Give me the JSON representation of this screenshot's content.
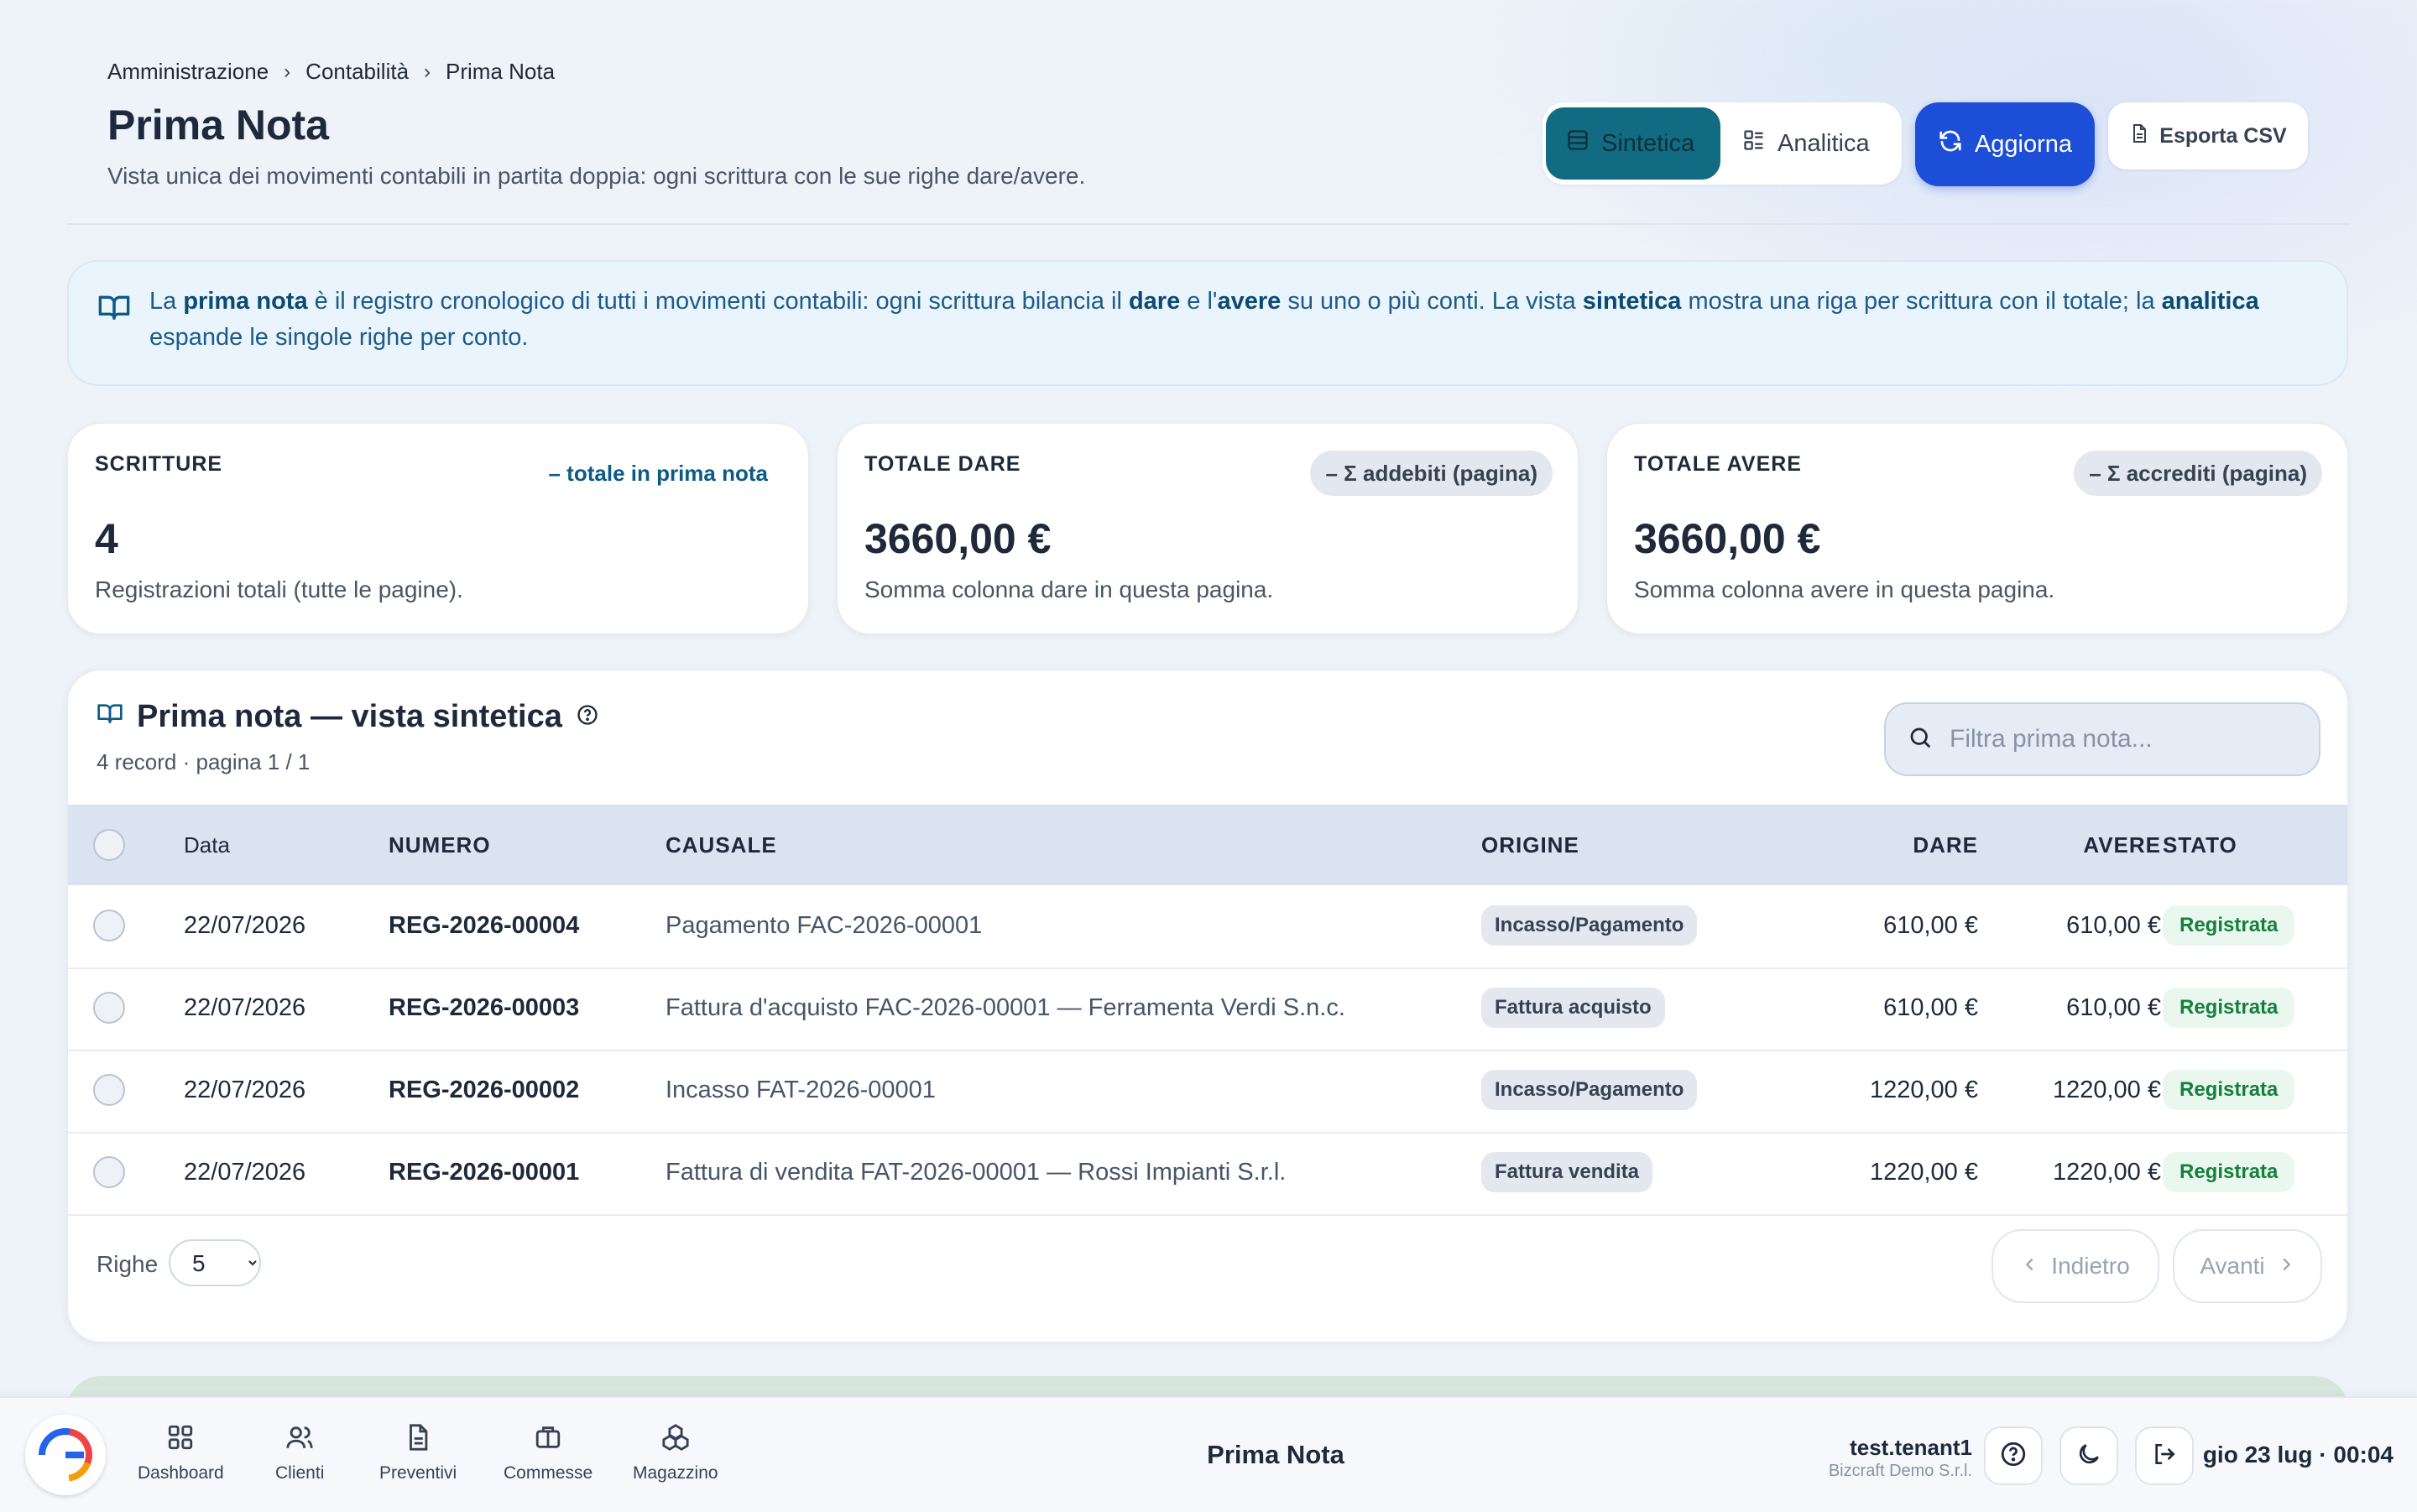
{
  "breadcrumb": [
    "Amministrazione",
    "Contabilità",
    "Prima Nota"
  ],
  "header": {
    "title": "Prima Nota",
    "subtitle": "Vista unica dei movimenti contabili in partita doppia: ogni scrittura con le sue righe dare/avere.",
    "view_sintetica": "Sintetica",
    "view_analitica": "Analitica",
    "refresh_label": "Aggiorna",
    "export_label": "Esporta CSV"
  },
  "info": {
    "t1": "La ",
    "b1": "prima nota",
    "t2": " è il registro cronologico di tutti i movimenti contabili: ogni scrittura bilancia il ",
    "b2": "dare",
    "t3": " e l'",
    "b3": "avere",
    "t4": " su uno o più conti. La vista ",
    "b4": "sintetica",
    "t5": " mostra una riga per scrittura con il totale; la ",
    "b5": "analitica",
    "t6": " espande le singole righe per conto."
  },
  "stats": [
    {
      "label": "SCRITTURE",
      "pill": "– totale in prima nota",
      "value": "4",
      "desc": "Registrazioni totali (tutte le pagine)."
    },
    {
      "label": "TOTALE DARE",
      "pill": "– Σ addebiti (pagina)",
      "value": "3660,00 €",
      "desc": "Somma colonna dare in questa pagina."
    },
    {
      "label": "TOTALE AVERE",
      "pill": "– Σ accrediti (pagina)",
      "value": "3660,00 €",
      "desc": "Somma colonna avere in questa pagina."
    }
  ],
  "table": {
    "title": "Prima nota — vista sintetica",
    "subtitle": "4 record · pagina 1 / 1",
    "search_placeholder": "Filtra prima nota...",
    "columns": {
      "data": "Data",
      "numero": "NUMERO",
      "causale": "CAUSALE",
      "origine": "ORIGINE",
      "dare": "DARE",
      "avere": "AVERE",
      "stato": "STATO"
    },
    "rows": [
      {
        "data": "22/07/2026",
        "numero": "REG-2026-00004",
        "causale": "Pagamento FAC-2026-00001",
        "origine": "Incasso/Pagamento",
        "dare": "610,00 €",
        "avere": "610,00 €",
        "stato": "Registrata"
      },
      {
        "data": "22/07/2026",
        "numero": "REG-2026-00003",
        "causale": "Fattura d'acquisto FAC-2026-00001 — Ferramenta Verdi S.n.c.",
        "origine": "Fattura acquisto",
        "dare": "610,00 €",
        "avere": "610,00 €",
        "stato": "Registrata"
      },
      {
        "data": "22/07/2026",
        "numero": "REG-2026-00002",
        "causale": "Incasso FAT-2026-00001",
        "origine": "Incasso/Pagamento",
        "dare": "1220,00 €",
        "avere": "1220,00 €",
        "stato": "Registrata"
      },
      {
        "data": "22/07/2026",
        "numero": "REG-2026-00001",
        "causale": "Fattura di vendita FAT-2026-00001 — Rossi Impianti S.r.l.",
        "origine": "Fattura vendita",
        "dare": "1220,00 €",
        "avere": "1220,00 €",
        "stato": "Registrata"
      }
    ],
    "rows_label": "Righe",
    "rows_per_page": "5",
    "prev_label": "Indietro",
    "next_label": "Avanti"
  },
  "bottombar": {
    "nav": [
      "Dashboard",
      "Clienti",
      "Preventivi",
      "Commesse",
      "Magazzino"
    ],
    "title": "Prima Nota",
    "user": "test.tenant1",
    "org": "Bizcraft Demo S.r.l.",
    "clock": "gio 23 lug · 00:04"
  },
  "colors": {
    "accent": "#116b82",
    "primary": "#1d4ed8",
    "success": "#15803d"
  }
}
